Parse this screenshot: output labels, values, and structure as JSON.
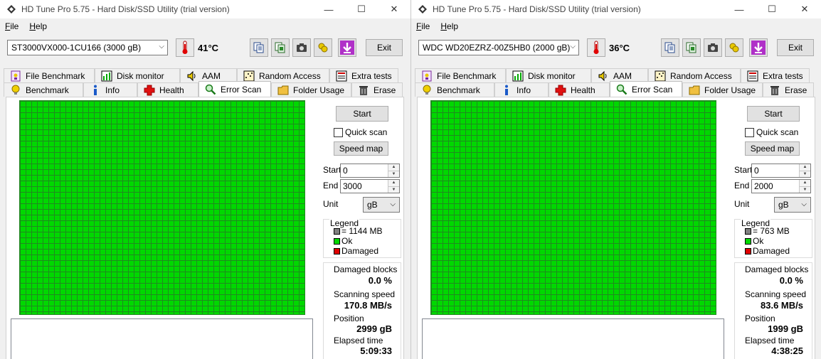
{
  "windows": [
    {
      "title": "HD Tune Pro 5.75 - Hard Disk/SSD Utility (trial version)",
      "menu": {
        "file": "F",
        "file_rest": "ile",
        "help": "H",
        "help_rest": "elp"
      },
      "drive": "ST3000VX000-1CU166 (3000 gB)",
      "temperature": "41°C",
      "exit_label": "Exit",
      "tabs_row1": [
        "File Benchmark",
        "Disk monitor",
        "AAM",
        "Random Access",
        "Extra tests"
      ],
      "tabs_row2": [
        "Benchmark",
        "Info",
        "Health",
        "Error Scan",
        "Folder Usage",
        "Erase"
      ],
      "start_label": "Start",
      "quick_scan_label": "Quick scan",
      "speed_map_label": "Speed map",
      "start_field_label": "Start",
      "end_field_label": "End",
      "start_value": "0",
      "end_value": "3000",
      "unit_label": "Unit",
      "unit_value": "gB",
      "legend": {
        "title": "Legend",
        "block_size": "= 1144 MB",
        "ok": "Ok",
        "damaged": "Damaged"
      },
      "stats": {
        "damaged_blocks_label": "Damaged blocks",
        "damaged_blocks_value": "0.0 %",
        "scanning_speed_label": "Scanning speed",
        "scanning_speed_value": "170.8 MB/s",
        "position_label": "Position",
        "position_value": "2999 gB",
        "elapsed_label": "Elapsed time",
        "elapsed_value": "5:09:33"
      }
    },
    {
      "title": "HD Tune Pro 5.75 - Hard Disk/SSD Utility (trial version)",
      "menu": {
        "file": "F",
        "file_rest": "ile",
        "help": "H",
        "help_rest": "elp"
      },
      "drive": "WDC WD20EZRZ-00Z5HB0 (2000 gB)",
      "temperature": "36°C",
      "exit_label": "Exit",
      "tabs_row1": [
        "File Benchmark",
        "Disk monitor",
        "AAM",
        "Random Access",
        "Extra tests"
      ],
      "tabs_row2": [
        "Benchmark",
        "Info",
        "Health",
        "Error Scan",
        "Folder Usage",
        "Erase"
      ],
      "start_label": "Start",
      "quick_scan_label": "Quick scan",
      "speed_map_label": "Speed map",
      "start_field_label": "Start",
      "end_field_label": "End",
      "start_value": "0",
      "end_value": "2000",
      "unit_label": "Unit",
      "unit_value": "gB",
      "legend": {
        "title": "Legend",
        "block_size": "= 763 MB",
        "ok": "Ok",
        "damaged": "Damaged"
      },
      "stats": {
        "damaged_blocks_label": "Damaged blocks",
        "damaged_blocks_value": "0.0 %",
        "scanning_speed_label": "Scanning speed",
        "scanning_speed_value": "83.6 MB/s",
        "position_label": "Position",
        "position_value": "1999 gB",
        "elapsed_label": "Elapsed time",
        "elapsed_value": "4:38:25"
      }
    }
  ],
  "colors": {
    "ok_block": "#00d800",
    "damaged_block": "#e00000",
    "used_block": "#808080",
    "grid_line": "#208a20"
  },
  "icons": {
    "tabs_row1": [
      "file-benchmark-icon",
      "disk-monitor-icon",
      "aam-speaker-icon",
      "random-access-icon",
      "extra-tests-icon"
    ],
    "tabs_row2": [
      "benchmark-bulb-icon",
      "info-icon",
      "health-cross-icon",
      "error-scan-magnifier-icon",
      "folder-usage-icon",
      "erase-trash-icon"
    ]
  }
}
